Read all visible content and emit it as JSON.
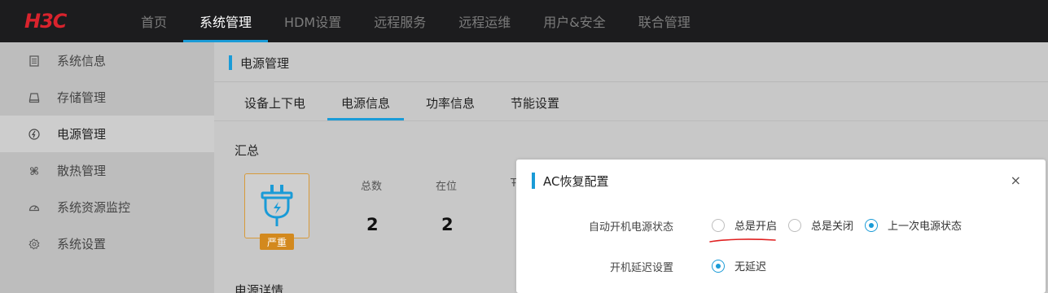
{
  "brand": {
    "logo_text": "H3C",
    "logo_color": "#d9232d"
  },
  "topnav": {
    "items": [
      {
        "label": "首页",
        "active": false
      },
      {
        "label": "系统管理",
        "active": true
      },
      {
        "label": "HDM设置",
        "active": false
      },
      {
        "label": "远程服务",
        "active": false
      },
      {
        "label": "远程运维",
        "active": false
      },
      {
        "label": "用户&安全",
        "active": false
      },
      {
        "label": "联合管理",
        "active": false
      }
    ]
  },
  "sidebar": {
    "items": [
      {
        "label": "系统信息",
        "icon": "document-icon",
        "active": false
      },
      {
        "label": "存储管理",
        "icon": "drive-icon",
        "active": false
      },
      {
        "label": "电源管理",
        "icon": "power-icon",
        "active": true
      },
      {
        "label": "散热管理",
        "icon": "fan-icon",
        "active": false
      },
      {
        "label": "系统资源监控",
        "icon": "gauge-icon",
        "active": false
      },
      {
        "label": "系统设置",
        "icon": "gear-icon",
        "active": false
      }
    ]
  },
  "main": {
    "title": "电源管理",
    "tabs": [
      {
        "label": "设备上下电",
        "active": false
      },
      {
        "label": "电源信息",
        "active": true
      },
      {
        "label": "功率信息",
        "active": false
      },
      {
        "label": "节能设置",
        "active": false
      }
    ],
    "summary": {
      "title": "汇总",
      "badge": "严重",
      "stats": [
        {
          "label": "总数",
          "value": "2"
        },
        {
          "label": "在位",
          "value": "2"
        }
      ],
      "partial_label": "Ŧ"
    },
    "detail_title": "电源详情"
  },
  "modal": {
    "title": "AC恢复配置",
    "close": "×",
    "auto_power_label": "自动开机电源状态",
    "auto_power_options": [
      {
        "label": "总是开启",
        "checked": false
      },
      {
        "label": "总是关闭",
        "checked": false
      },
      {
        "label": "上一次电源状态",
        "checked": true
      }
    ],
    "delay_label": "开机延迟设置",
    "delay_options": [
      {
        "label": "无延迟",
        "checked": true
      }
    ]
  },
  "colors": {
    "accent": "#1a9bd7",
    "warning": "#d3891e",
    "annotation": "#e02020"
  }
}
